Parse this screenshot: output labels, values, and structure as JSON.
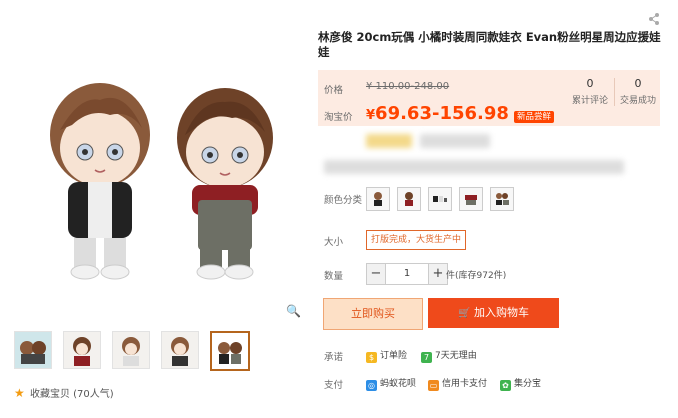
{
  "product": {
    "title": "林彦俊 20cm玩偶 小橘时装周同款娃衣 Evan粉丝明星周边应援娃娃"
  },
  "price": {
    "original_label": "价格",
    "original_value": "¥ 110.00-248.00",
    "taobao_label": "淘宝价",
    "currency": "¥",
    "taobao_value": "69.63-156.98",
    "badge": "新品尝鲜"
  },
  "stats": {
    "reviews_count": "0",
    "reviews_label": "累计评论",
    "sales_count": "0",
    "sales_label": "交易成功"
  },
  "options": {
    "color_label": "颜色分类",
    "size_label": "大小",
    "size_value": "打版完成，大货生产中",
    "quantity_label": "数量",
    "quantity_value": "1",
    "stock_text": "件(库存972件)"
  },
  "actions": {
    "buy_now": "立即购买",
    "add_cart": "加入购物车"
  },
  "promise": {
    "label": "承诺",
    "item1": "订单险",
    "item2": "7天无理由"
  },
  "payment": {
    "label": "支付",
    "item1": "蚂蚁花呗",
    "item2": "信用卡支付",
    "item3": "集分宝"
  },
  "favorite": {
    "text": "收藏宝贝",
    "count": "(70人气)"
  },
  "icons": {
    "minus": "−",
    "plus": "+",
    "star": "★",
    "cart": "🛒"
  }
}
